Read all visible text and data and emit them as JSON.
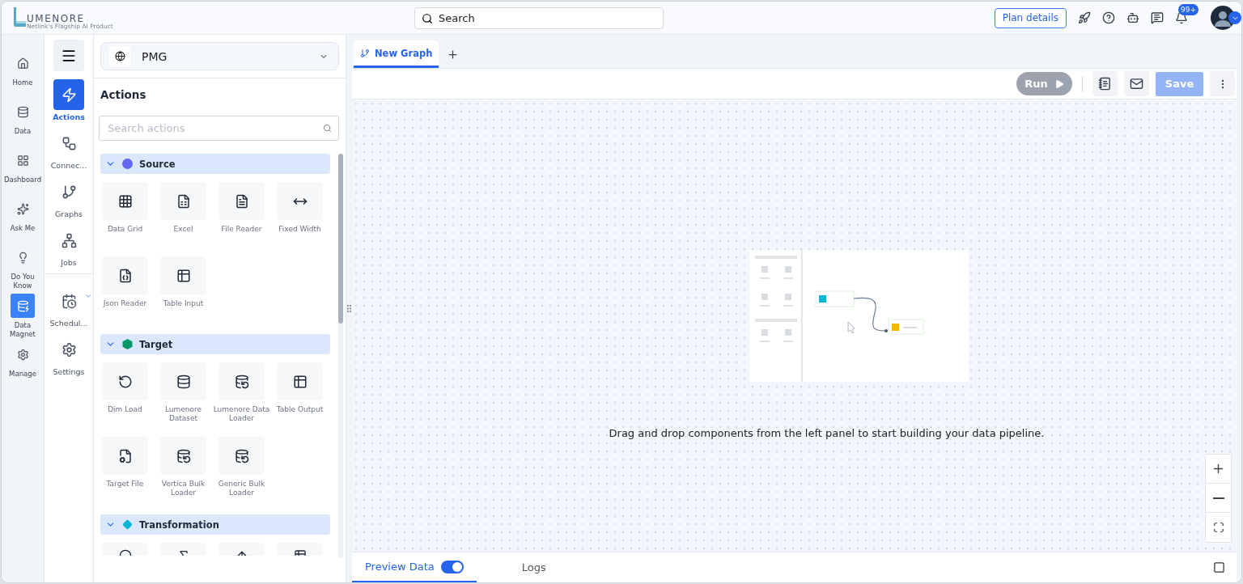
{
  "header": {
    "logo": {
      "name": "UMENORE",
      "tagline": "Netlink's Flagship AI Product"
    },
    "search": {
      "placeholder": "Search"
    },
    "plan_button": "Plan details",
    "notifications": {
      "badge": "99+"
    }
  },
  "main_nav": [
    {
      "label": "Home",
      "selected": false
    },
    {
      "label": "Data",
      "selected": false
    },
    {
      "label": "Dashboard",
      "selected": false
    },
    {
      "label": "Ask Me",
      "selected": false
    },
    {
      "label": "Do You Know",
      "selected": false
    },
    {
      "label": "Data Magnet",
      "selected": true
    },
    {
      "label": "Manage",
      "selected": false
    }
  ],
  "sub_nav": [
    {
      "label": "Actions",
      "selected": true,
      "expandable": false
    },
    {
      "label": "Connec...",
      "selected": false,
      "expandable": false
    },
    {
      "label": "Graphs",
      "selected": false,
      "expandable": false
    },
    {
      "label": "Jobs",
      "selected": false,
      "expandable": false
    },
    {
      "label": "Schedul...",
      "selected": false,
      "expandable": true
    },
    {
      "label": "Settings",
      "selected": false,
      "expandable": false
    }
  ],
  "actions_panel": {
    "workspace": "PMG",
    "title": "Actions",
    "search": {
      "placeholder": "Search actions"
    },
    "sections": [
      {
        "name": "Source",
        "expanded": true,
        "color": "#6366f1",
        "items": [
          {
            "kind": "tile",
            "label": "Data Grid"
          },
          {
            "kind": "tile",
            "label": "Excel"
          },
          {
            "kind": "tile",
            "label": "File Reader"
          },
          {
            "kind": "tile",
            "label": "Fixed Width"
          },
          {
            "kind": "tile",
            "label": "Json Reader"
          },
          {
            "kind": "tile",
            "label": "Table Input"
          }
        ]
      },
      {
        "name": "Target",
        "expanded": true,
        "color": "#059669",
        "items": [
          {
            "kind": "tile",
            "label": "Dim Load"
          },
          {
            "kind": "tile",
            "label": "Lumenore Dataset"
          },
          {
            "kind": "tile",
            "label": "Lumenore Data Loader"
          },
          {
            "kind": "tile",
            "label": "Table Output"
          },
          {
            "kind": "tile",
            "label": "Target File"
          },
          {
            "kind": "tile",
            "label": "Vertica Bulk Loader"
          },
          {
            "kind": "tile",
            "label": "Generic Bulk Loader"
          }
        ]
      },
      {
        "name": "Transformation",
        "expanded": true,
        "color": "#06b6d4",
        "items": [
          {
            "kind": "clipped"
          },
          {
            "kind": "clipped"
          },
          {
            "kind": "clipped"
          },
          {
            "kind": "clipped"
          }
        ]
      }
    ]
  },
  "tabs": [
    {
      "label": "New Graph",
      "selected": true
    }
  ],
  "toolbar": {
    "run": {
      "label": "Run",
      "disabled": true
    },
    "save": {
      "label": "Save",
      "disabled": true
    }
  },
  "canvas": {
    "message": "Drag and drop components from the left panel to start building your data pipeline."
  },
  "bottom_tabs": [
    {
      "label": "Preview Data",
      "selected": true,
      "toggle": true
    },
    {
      "label": "Logs",
      "selected": false
    }
  ]
}
